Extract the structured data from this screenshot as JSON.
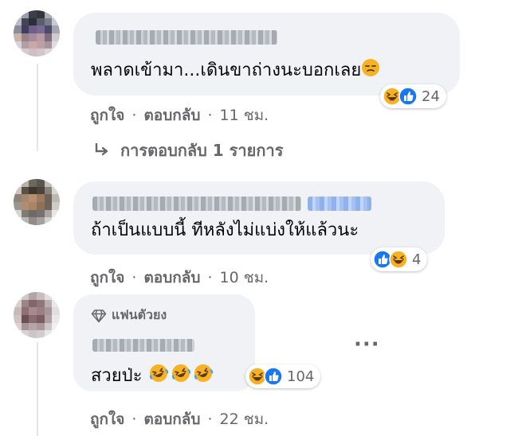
{
  "comments": [
    {
      "text": "พลาดเข้ามา...เดินขาถ่างนะบอกเลย",
      "reactions": {
        "icons": [
          "haha-icon",
          "like-icon"
        ],
        "count": "24"
      },
      "actions": {
        "like": "ถูกใจ",
        "reply": "ตอบกลับ",
        "time": "11 ชม."
      },
      "replies_link": "การตอบกลับ 1 รายการ"
    },
    {
      "text": "ถ้าเป็นแบบนี้ ทีหลังไม่แบ่งให้แล้วนะ",
      "reactions": {
        "icons": [
          "like-icon",
          "haha-icon"
        ],
        "count": "4"
      },
      "actions": {
        "like": "ถูกใจ",
        "reply": "ตอบกลับ",
        "time": "10 ชม."
      }
    },
    {
      "badge": "แฟนตัวยง",
      "text": "สวยป่ะ",
      "reactions": {
        "icons": [
          "haha-icon",
          "like-icon"
        ],
        "count": "104"
      },
      "actions": {
        "like": "ถูกใจ",
        "reply": "ตอบกลับ",
        "time": "22 ชม."
      }
    }
  ],
  "colors": {
    "bubble": "#f0f2f5",
    "secondary_text": "#65676b",
    "like_blue": "#1877f2",
    "haha_yellow": "#f7b125"
  }
}
